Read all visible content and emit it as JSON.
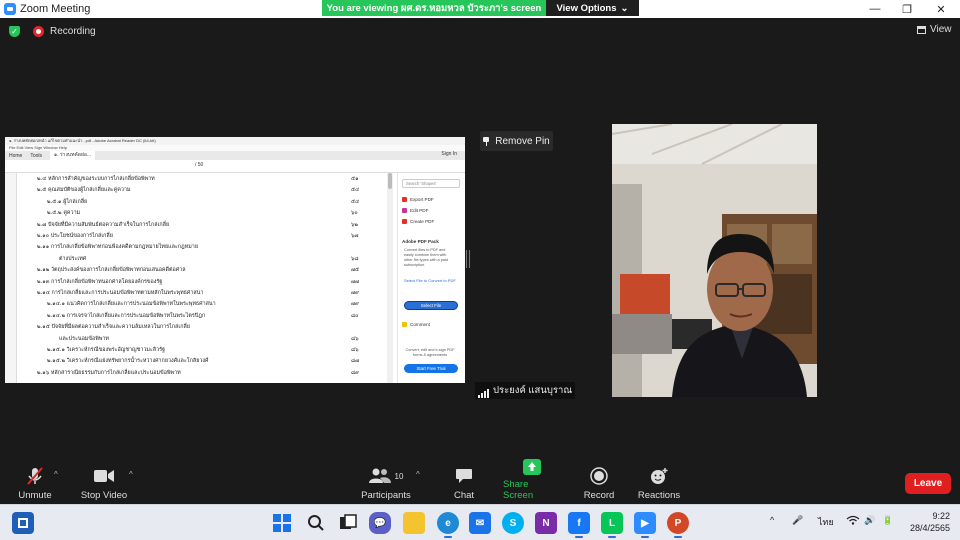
{
  "window": {
    "title": "Zoom Meeting",
    "minimize": "—",
    "restore": "❐",
    "close": "✕"
  },
  "banner": {
    "text": "You are viewing ผศ.ดร.หอมหวล บัวระภา's screen",
    "view_options": "View Options",
    "caret": "⌄"
  },
  "status": {
    "recording": "Recording",
    "view": "View"
  },
  "pin": {
    "label": "Remove Pin"
  },
  "speaker": {
    "name": "ประยงค์ แสนบุราณ"
  },
  "shared_app": {
    "title": "๑. ร่างบทคัดย่อ/บทนำ แก้ไขตามคำแนะนำ...pdf - Adobe Acrobat Reader DC (64-bit)",
    "menu": "File   Edit   View   Sign   Window   Help",
    "tabs": [
      "Home",
      "Tools",
      "๑. ร่างบทคัดย่อ..."
    ],
    "page_indicator": "/ 50",
    "sign_in": "Sign In",
    "toc": [
      {
        "text": "๒.๔ หลักการสำคัญของระบบการไกล่เกลี่ยข้อพิพาท",
        "page": "๕๑",
        "indent": 0
      },
      {
        "text": "๒.๕ คุณสมบัติของผู้ไกล่เกลี่ยและคู่ความ",
        "page": "๕๔",
        "indent": 0
      },
      {
        "text": "๒.๕.๑ ผู้ไกล่เกลี่ย",
        "page": "๕๔",
        "indent": 1
      },
      {
        "text": "๒.๕.๒ คู่ความ",
        "page": "๖๐",
        "indent": 1
      },
      {
        "text": "๒.๗ ปัจจัยที่มีความสัมพันธ์ต่อความสำเร็จในการไกล่เกลี่ย",
        "page": "๖๒",
        "indent": 0
      },
      {
        "text": "๒.๑๐ ประโยชน์ของการไกล่เกลี่ย",
        "page": "๖๗",
        "indent": 0
      },
      {
        "text": "๒.๑๑ การไกล่เกลี่ยข้อพิพาทก่อนฟ้องคดีตามกฎหมายไทยและกฎหมาย",
        "page": "",
        "indent": 0
      },
      {
        "text": "ต่างประเทศ",
        "page": "๖๘",
        "indent": 2
      },
      {
        "text": "๒.๑๒ วัตถุประสงค์ของการไกล่เกลี่ยข้อพิพาทก่อนเสนอคดีต่อศาล",
        "page": "๗๕",
        "indent": 0
      },
      {
        "text": "๒.๑๓ การไกล่เกลี่ยข้อพิพาทนอกศาลโดยองค์กรของรัฐ",
        "page": "๗๗",
        "indent": 0
      },
      {
        "text": "๒.๑๔ การไกล่เกลี่ยและการประนอมข้อพิพาทตามหลักในพระพุทธศาสนา",
        "page": "๗๙",
        "indent": 0
      },
      {
        "text": "๒.๑๔.๑ แนวคิดการไกล่เกลี่ยและการประนอมข้อพิพาทในพระพุทธศาสนา",
        "page": "๗๙",
        "indent": 1
      },
      {
        "text": "๒.๑๔.๒ การเจรจาไกล่เกลี่ยและการประนอมข้อพิพาทในพระไตรปิฎก",
        "page": "๘๐",
        "indent": 1
      },
      {
        "text": "๒.๑๕ ปัจจัยที่มีผลต่อความสำเร็จและความล้มเหลวในการไกล่เกลี่ย",
        "page": "",
        "indent": 0
      },
      {
        "text": "และประนอมข้อพิพาท",
        "page": "๘๖",
        "indent": 2
      },
      {
        "text": "๒.๑๕.๑ วิเคราะห์กรณีของพระอัญชาญชาวมะลิวรัฐ",
        "page": "๘๖",
        "indent": 1
      },
      {
        "text": "๒.๑๕.๒ วิเคราะห์กรณีแย่งทรัพยากรน้ำระหว่างศากยวงศ์และโกลิยวงศ์",
        "page": "๘๗",
        "indent": 1
      },
      {
        "text": "๒.๑๖ หลักสาราณียธรรมกับการไกล่เกลี่ยและประนอมข้อพิพาท",
        "page": "๘๙",
        "indent": 0
      }
    ],
    "right_pane": {
      "search": "Search 'Shapes'",
      "items": [
        "Export PDF",
        "Edit PDF",
        "Create PDF",
        "Comment"
      ],
      "promo_title": "Adobe PDF Pack",
      "promo_text": "Convert files to PDF and easily combine them with other file types with a paid subscription.",
      "link": "Select File to Convert to PDF",
      "select_button": "Select File",
      "bottom_text": "Convert, edit and e-sign PDF forms & agreements",
      "trial_button": "Start Free Trial"
    }
  },
  "controls": {
    "unmute": "Unmute",
    "stop_video": "Stop Video",
    "participants": "Participants",
    "participant_count": "10",
    "chat": "Chat",
    "share_screen": "Share Screen",
    "record": "Record",
    "reactions": "Reactions",
    "leave": "Leave"
  },
  "taskbar": {
    "lang": "ไทย",
    "time": "9:22",
    "date": "28/4/2565"
  }
}
